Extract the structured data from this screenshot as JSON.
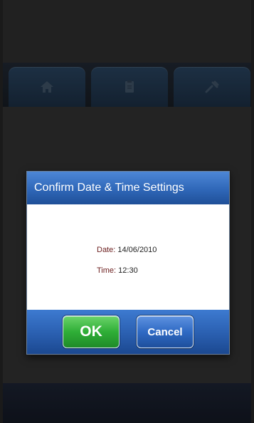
{
  "tabs": [
    {
      "icon": "home-icon"
    },
    {
      "icon": "document-icon"
    },
    {
      "icon": "tools-icon"
    }
  ],
  "dialog": {
    "title": "Confirm Date & Time Settings",
    "date_label": "Date: ",
    "date_value": "14/06/2010",
    "time_label": "Time: ",
    "time_value": "12:30",
    "ok_label": "OK",
    "cancel_label": "Cancel"
  },
  "colors": {
    "header_blue": "#2f67b8",
    "ok_green": "#2fae37",
    "cancel_blue": "#2f6ac4"
  }
}
